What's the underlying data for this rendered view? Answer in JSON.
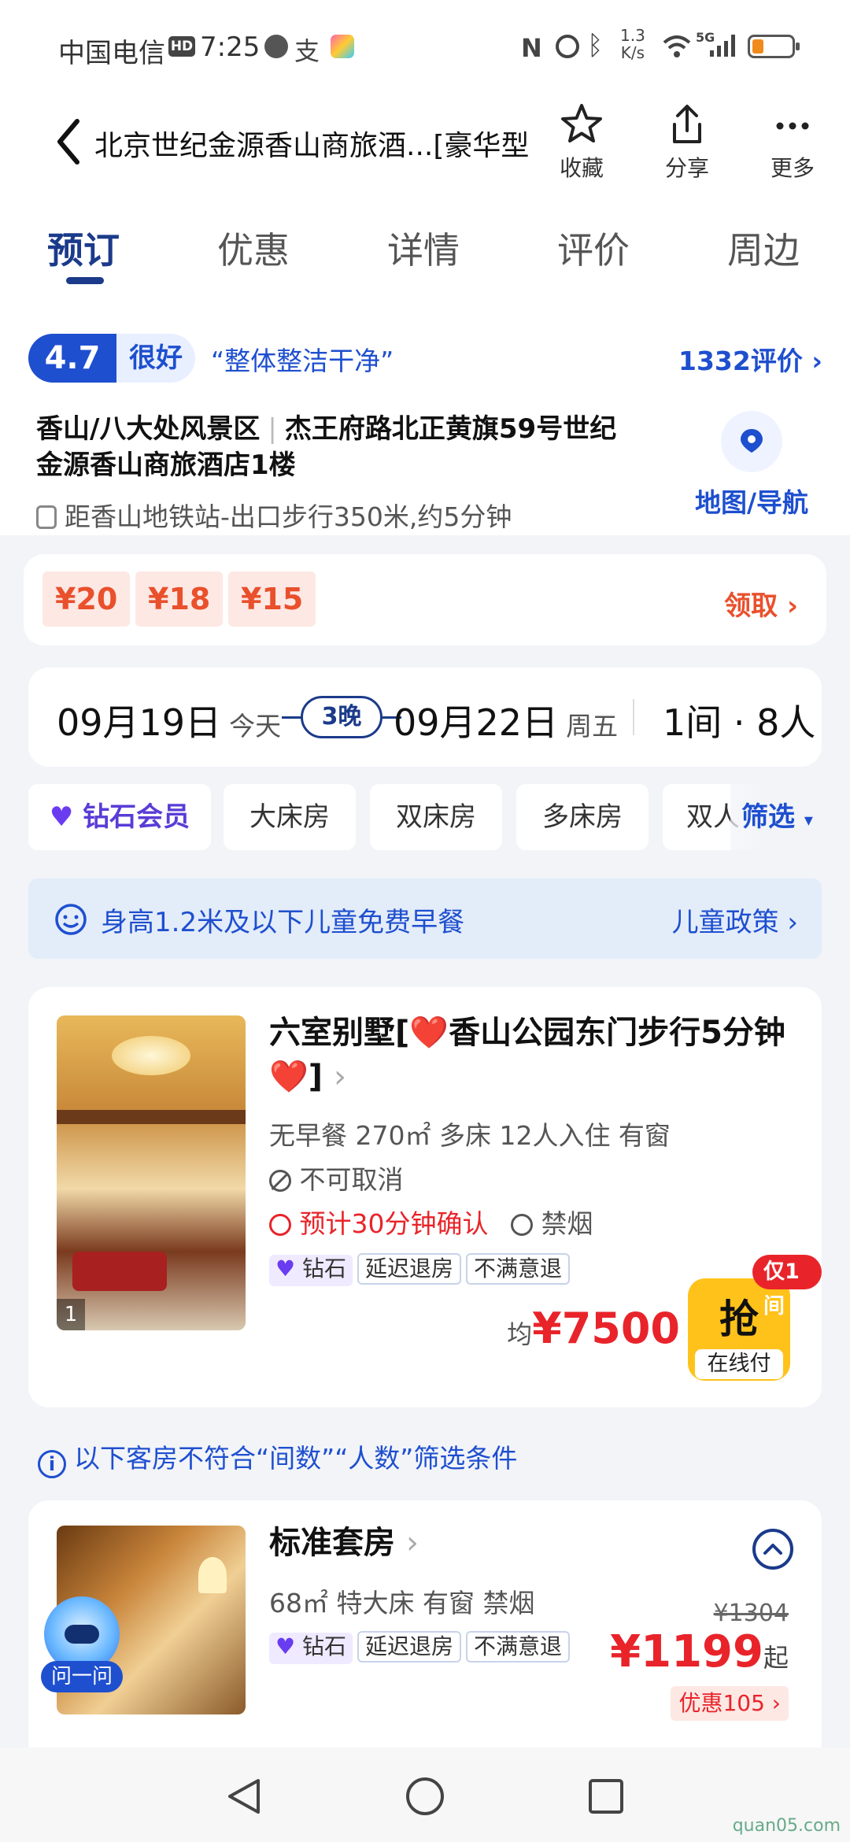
{
  "status_bar": {
    "carrier": "中国电信",
    "time": "7:25",
    "speed_value": "1.3",
    "speed_unit": "K/s",
    "network": "5G"
  },
  "header": {
    "title": "北京世纪金源香山商旅酒...[豪华型",
    "favorite_label": "收藏",
    "share_label": "分享",
    "more_label": "更多"
  },
  "tabs": [
    "预订",
    "优惠",
    "详情",
    "评价",
    "周边"
  ],
  "hotel": {
    "rating": "4.7",
    "rating_word": "很好",
    "quote": "“整体整洁干净”",
    "review_count": "1332评价",
    "area": "香山/八大处风景区",
    "address_line1": "杰王府路北正黄旗59号世纪",
    "address_line2": "金源香山商旅酒店1楼",
    "subway": "距香山地铁站-出口步行350米,约5分钟",
    "map_label": "地图/导航"
  },
  "coupons": {
    "items": [
      "¥20",
      "¥18",
      "¥15"
    ],
    "get_label": "领取"
  },
  "dates": {
    "checkin": "09月19日",
    "checkin_day": "今天",
    "nights": "3晚",
    "checkout": "09月22日",
    "checkout_day": "周五",
    "guests": "1间 · 8人"
  },
  "filters": {
    "chips": [
      "钻石会员",
      "大床房",
      "双床房",
      "多床房",
      "双人"
    ],
    "filter_label": "筛选"
  },
  "kids_banner": {
    "text": "身高1.2米及以下儿童免费早餐",
    "link": "儿童政策"
  },
  "room1": {
    "name": "六室别墅[❤️香山公园东门步行5分钟❤️]",
    "specs": "无早餐  270㎡  多床  12人入住  有窗",
    "cancel": "不可取消",
    "confirm": "预计30分钟确认",
    "smoke": "禁烟",
    "tag_diamond": "钻石",
    "tag_checkout": "延迟退房",
    "tag_refund": "不满意退",
    "price_prefix": "均",
    "price": "¥7500",
    "grab_label": "抢",
    "pay_label": "在线付",
    "only_one": "仅1间",
    "image_count": "1"
  },
  "note": "以下客房不符合“间数”“人数”筛选条件",
  "room2": {
    "name": "标准套房",
    "specs": "68㎡  特大床  有窗  禁烟",
    "tag_diamond": "钻石",
    "tag_checkout": "延迟退房",
    "tag_refund": "不满意退",
    "original_price": "¥1304",
    "price": "¥1199",
    "price_suffix": "起",
    "discount": "优惠105",
    "ask_label": "问一问"
  },
  "watermark": "quan05.com",
  "colors": {
    "brand_blue": "#1e4fcf",
    "tab_active": "#1b3a8a",
    "price_red": "#e8242a",
    "coupon_orange": "#e9502c",
    "grab_yellow": "#ffc21a"
  }
}
